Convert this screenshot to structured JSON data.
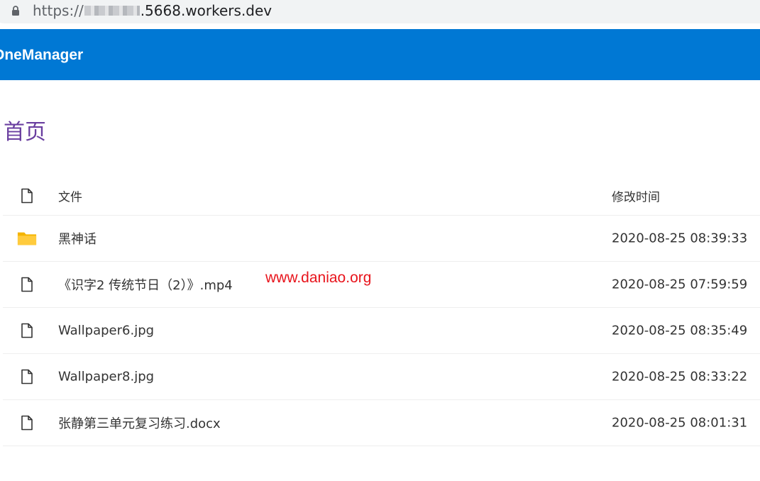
{
  "browser": {
    "url_protocol": "https://",
    "url_domain": ".5668.workers.dev"
  },
  "header": {
    "brand": "OneManager"
  },
  "breadcrumb": {
    "current": "首页"
  },
  "table": {
    "columns": {
      "name": "文件",
      "modified": "修改时间"
    },
    "rows": [
      {
        "type": "folder",
        "icon": "folder-icon",
        "name": "黑神话",
        "modified": "2020-08-25 08:39:33"
      },
      {
        "type": "file",
        "icon": "file-icon",
        "name": "《识字2 传统节日（2）》.mp4",
        "modified": "2020-08-25 07:59:59"
      },
      {
        "type": "file",
        "icon": "file-icon",
        "name": "Wallpaper6.jpg",
        "modified": "2020-08-25 08:35:49"
      },
      {
        "type": "file",
        "icon": "file-icon",
        "name": "Wallpaper8.jpg",
        "modified": "2020-08-25 08:33:22"
      },
      {
        "type": "file",
        "icon": "file-icon",
        "name": "张静第三单元复习练习.docx",
        "modified": "2020-08-25 08:01:31"
      }
    ]
  },
  "watermark": "www.daniao.org",
  "colors": {
    "header_bg": "#0078d4",
    "breadcrumb": "#6a3fa0",
    "folder": "#ffcb3d",
    "watermark": "#e8141c"
  }
}
